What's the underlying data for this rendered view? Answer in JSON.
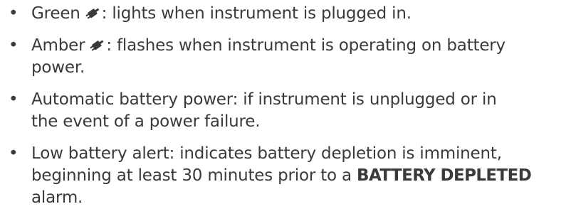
{
  "bullets": [
    {
      "lead": "Green",
      "icon": "plug-icon",
      "rest": ":  lights when instrument is plugged in."
    },
    {
      "lead": "Amber",
      "icon": "plug-icon",
      "rest_line1": ":  flashes when instrument is operating on battery",
      "rest_line2": "power."
    },
    {
      "line1": "Automatic battery power:  if instrument is unplugged or in",
      "line2": "the event of a power failure."
    },
    {
      "line1": "Low battery alert:  indicates battery depletion is imminent,",
      "line2_pre": "beginning at least 30 minutes prior to a ",
      "line2_bold": "BATTERY DEPLETED",
      "line3": "alarm."
    }
  ],
  "bullet_char": "•"
}
